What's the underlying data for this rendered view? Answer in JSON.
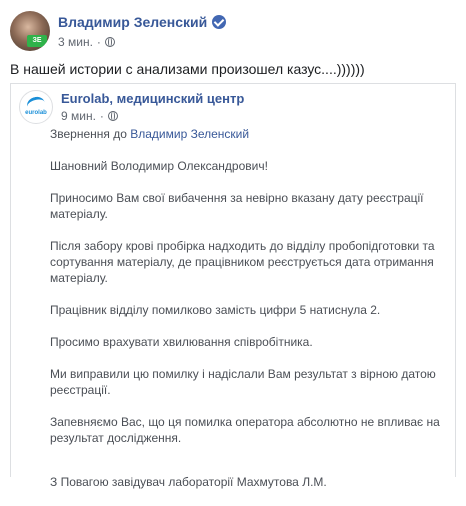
{
  "post": {
    "author": "Владимир Зеленский",
    "avatar_badge": "ЗЕ",
    "time": "3 мин.",
    "separator": "·",
    "text": "В нашей истории с анализами произошел казус....))))))"
  },
  "shared_post": {
    "author": "Eurolab, медицинский центр",
    "logo_text": "eurolab",
    "time": "9 мин.",
    "separator": "·",
    "body": {
      "address_prefix": "Звернення до ",
      "address_name": "Владимир Зеленский",
      "greeting": "Шановний Володимир Олександрович!",
      "p1": "Приносимо Вам свої вибачення за невірно вказану дату реєстрації матеріалу.",
      "p2": "Після забору крові пробірка надходить до відділу пробопідготовки та сортування матеріалу, де працівником реєструється дата отримання матеріалу.",
      "p3": "Працівник відділу помилково замість цифри 5 натиснула 2.",
      "p4": "Просимо врахувати хвилювання співробітника.",
      "p5": "Ми виправили цю помилку і надіслали Вам результат з вірною датою реєстрації.",
      "p6": "Запевняємо Вас, що ця помилка оператора абсолютно не впливає на результат дослідження.",
      "signature": "З Повагою завідувач лабораторії Махмутова Л.М."
    }
  },
  "colors": {
    "link_blue": "#385898",
    "verified_blue": "#4267b2",
    "meta_gray": "#616770",
    "text_dark": "#1c1e21",
    "body_gray": "#4b4f56",
    "border": "#dddfe2"
  },
  "icons": [
    "verified-badge-icon",
    "globe-icon"
  ]
}
